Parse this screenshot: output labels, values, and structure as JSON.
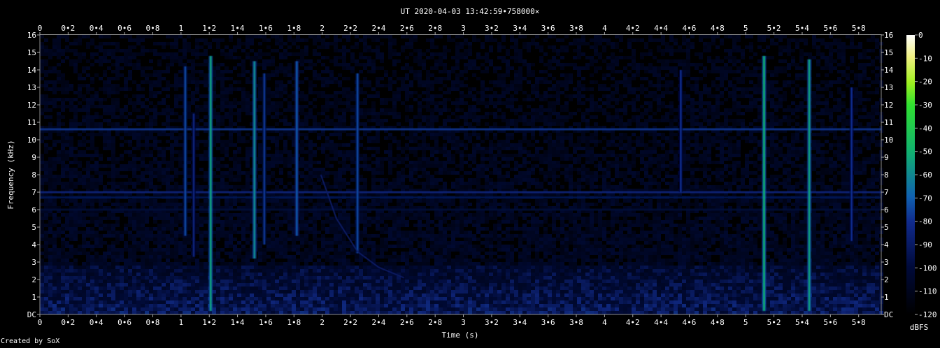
{
  "chart_data": {
    "type": "heatmap",
    "title": "UT 2020-04-03 13:42:59•758000×",
    "xlabel": "Time (s)",
    "ylabel": "Frequency (kHz)",
    "xlim": [
      0,
      5.96
    ],
    "ylim": [
      0,
      16
    ],
    "x_ticks": [
      "0",
      "0•2",
      "0•4",
      "0•6",
      "0•8",
      "1",
      "1•2",
      "1•4",
      "1•6",
      "1•8",
      "2",
      "2•2",
      "2•4",
      "2•6",
      "2•8",
      "3",
      "3•2",
      "3•4",
      "3•6",
      "3•8",
      "4",
      "4•2",
      "4•4",
      "4•6",
      "4•8",
      "5",
      "5•2",
      "5•4",
      "5•6",
      "5•8"
    ],
    "y_ticks": [
      "DC",
      "1",
      "2",
      "3",
      "4",
      "5",
      "6",
      "7",
      "8",
      "9",
      "10",
      "11",
      "12",
      "13",
      "14",
      "15",
      "16"
    ],
    "colorbar": {
      "label": "dBFS",
      "range": [
        -120,
        0
      ],
      "ticks": [
        "0",
        "-10",
        "-20",
        "-30",
        "-40",
        "-50",
        "-60",
        "-70",
        "-80",
        "-90",
        "-100",
        "-110",
        "-120"
      ]
    },
    "colors": {
      "background": "#000000",
      "noise": "#0a1a4a",
      "hum": "#3050c8",
      "strong": "#20c0a0"
    },
    "features": {
      "hum_lines_khz": [
        10.6,
        7.0,
        6.7,
        6.0
      ],
      "hum_level_dbfs": -88,
      "vertical_bursts": [
        {
          "t": 1.03,
          "f_low": 4.5,
          "f_high": 14.2,
          "level_dbfs": -85
        },
        {
          "t": 1.09,
          "f_low": 3.3,
          "f_high": 11.5,
          "level_dbfs": -92
        },
        {
          "t": 1.21,
          "f_low": 0.2,
          "f_high": 14.8,
          "level_dbfs": -72
        },
        {
          "t": 1.52,
          "f_low": 3.2,
          "f_high": 14.5,
          "level_dbfs": -75
        },
        {
          "t": 1.59,
          "f_low": 4.0,
          "f_high": 13.8,
          "level_dbfs": -88
        },
        {
          "t": 1.82,
          "f_low": 4.5,
          "f_high": 14.5,
          "level_dbfs": -82
        },
        {
          "t": 2.25,
          "f_low": 3.5,
          "f_high": 13.8,
          "level_dbfs": -85
        },
        {
          "t": 4.54,
          "f_low": 7.0,
          "f_high": 14.0,
          "level_dbfs": -90
        },
        {
          "t": 5.13,
          "f_low": 0.2,
          "f_high": 14.8,
          "level_dbfs": -70
        },
        {
          "t": 5.45,
          "f_low": 0.2,
          "f_high": 14.6,
          "level_dbfs": -72
        },
        {
          "t": 5.75,
          "f_low": 4.2,
          "f_high": 13.0,
          "level_dbfs": -90
        }
      ],
      "sweep": {
        "points": [
          [
            1.99,
            8.0
          ],
          [
            2.1,
            5.5
          ],
          [
            2.25,
            3.6
          ],
          [
            2.4,
            2.7
          ],
          [
            2.58,
            2.1
          ]
        ],
        "level_dbfs": -95
      },
      "low_band_khz": [
        0,
        3
      ],
      "low_band_level_dbfs": -100
    }
  },
  "footer": {
    "credit": "Created by SoX"
  }
}
